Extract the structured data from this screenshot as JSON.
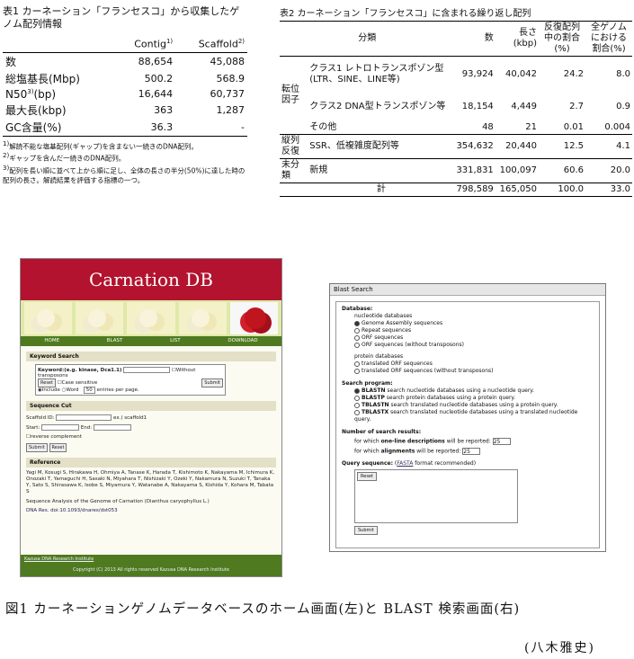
{
  "table1": {
    "caption": "表1 カーネーション「フランセスコ」から収集したゲノム配列情報",
    "col_contig": "Contig",
    "col_contig_sup": "1)",
    "col_scaffold": "Scaffold",
    "col_scaffold_sup": "2)",
    "rows": [
      {
        "label": "数",
        "sup": "",
        "suffix": "",
        "contig": "88,654",
        "scaffold": "45,088"
      },
      {
        "label": "総塩基長(Mbp)",
        "sup": "",
        "suffix": "",
        "contig": "500.2",
        "scaffold": "568.9"
      },
      {
        "label": "N50",
        "sup": "3)",
        "suffix": "(bp)",
        "contig": "16,644",
        "scaffold": "60,737"
      },
      {
        "label": "最大長(kbp)",
        "sup": "",
        "suffix": "",
        "contig": "363",
        "scaffold": "1,287"
      },
      {
        "label": "GC含量(%)",
        "sup": "",
        "suffix": "",
        "contig": "36.3",
        "scaffold": "-"
      }
    ],
    "footnotes": [
      {
        "mark": "1)",
        "text": "解読不能な塩基配列(ギャップ)を含まない一続きのDNA配列。"
      },
      {
        "mark": "2)",
        "text": "ギャップを含んだ一続きのDNA配列。"
      },
      {
        "mark": "3)",
        "text": "配列を長い順に並べて上から順に足し、全体の長さの半分(50%)に達した時の配列の長さ。解読結果を評価する指標の一つ。"
      }
    ]
  },
  "table2": {
    "caption": "表2 カーネーション「フランセスコ」に含まれる繰り返し配列",
    "headers": {
      "category": "分類",
      "count": "数",
      "length": "長さ(kbp)",
      "ratio_repeat": "反復配列中の割合(%)",
      "ratio_genome": "全ゲノムにおける割合(%)"
    },
    "group_transposon": "転位因子",
    "rows": [
      {
        "group": "",
        "name": "クラス1 レトロトランスポゾン型 (LTR、SINE、LINE等)",
        "count": "93,924",
        "length": "40,042",
        "r1": "24.2",
        "r2": "8.0"
      },
      {
        "group": "",
        "name": "クラス2 DNA型トランスポゾン等",
        "count": "18,154",
        "length": "4,449",
        "r1": "2.7",
        "r2": "0.9"
      },
      {
        "group": "",
        "name": "その他",
        "count": "48",
        "length": "21",
        "r1": "0.01",
        "r2": "0.004"
      },
      {
        "group": "縦列反復",
        "name": "SSR、低複雑度配列等",
        "count": "354,632",
        "length": "20,440",
        "r1": "12.5",
        "r2": "4.1"
      },
      {
        "group": "未分類",
        "name": "新規",
        "count": "331,831",
        "length": "100,097",
        "r1": "60.6",
        "r2": "20.0"
      },
      {
        "group": "",
        "name": "計",
        "count": "798,589",
        "length": "165,050",
        "r1": "100.0",
        "r2": "33.0"
      }
    ]
  },
  "carnation_db": {
    "title": "Carnation DB",
    "nav": [
      "HOME",
      "BLAST",
      "LIST",
      "DOWNLOAD"
    ],
    "keyword_search": "Keyword Search",
    "keyword_label": "Keyword:(e.g. kinase, Dca1.1)",
    "without_transposons": "Without transposons",
    "reset": "Reset",
    "submit": "Submit",
    "case_sensitive": "Case sensitive",
    "include": "Include",
    "word": "Word",
    "per_page": "entries per page.",
    "per_page_value": "50",
    "sequence_cut": "Sequence Cut",
    "scaffold_id": "Scaffold ID:",
    "scaffold_eg": "ex.) scaffold1",
    "start": "Start:",
    "end": "End:",
    "reverse_complement": "reverse complement",
    "reference": "Reference",
    "authors": "Yagi M, Kosugi S, Hirakawa H, Ohmiya A, Tanase K, Harada T, Kishimoto K, Nakayama M, Ichimura K, Onozaki T, Yamaguchi H, Sasaki N, Miyahara T, Nishizaki Y, Ozeki Y, Nakamura N, Suzuki T, Tanaka Y, Sato S, Shirasawa K, Isobe S, Miyamura Y, Watanabe A, Nakayama S, Kishida Y, Kohara M, Tabata S",
    "paper_title": "Sequence Analysis of the Genome of Carnation (Dianthus caryophyllus L.)",
    "doi": "DNA Res. doi:10.1093/dnares/dst053",
    "footer_inst": "Kazusa DNA Research Institute",
    "copyright": "Copyright (C) 2013 All rights reserved Kazusa DNA Research Institute"
  },
  "blast": {
    "title": "Blast Search",
    "database": "Database:",
    "nucleotide_db": "nucleotide databases",
    "nuc_opts": [
      "Genome Assembly sequences",
      "Repeat sequences",
      "ORF sequences",
      "ORF sequences (without transposons)"
    ],
    "protein_db": "protein databases",
    "prot_opts": [
      "translated ORF sequences",
      "translated ORF sequences (without transposons)"
    ],
    "program": "Search program:",
    "programs": [
      {
        "name": "BLASTN",
        "desc": "search nucleotide databases using a nucleotide query."
      },
      {
        "name": "BLASTP",
        "desc": "search protein databases using a protein query."
      },
      {
        "name": "TBLASTN",
        "desc": "search translated nucleotide databases using a protein query."
      },
      {
        "name": "TBLASTX",
        "desc": "search translated nucleotide databases using a translated nucleotide query."
      }
    ],
    "results": "Number of search results:",
    "oneline_pre": "for which",
    "oneline_b": "one-line descriptions",
    "oneline_post": "will be reported:",
    "oneline_val": "25",
    "align_pre": "for which",
    "align_b": "alignments",
    "align_post": "will be reported:",
    "align_val": "25",
    "query": "Query sequence:",
    "fasta": "FASTA",
    "query_note": "format recommended)",
    "reset": "Reset",
    "submit": "Submit"
  },
  "figure_caption": "図1 カーネーションゲノムデータベースのホーム画面(左)と BLAST 検索画面(右)",
  "author": "(八木雅史)"
}
